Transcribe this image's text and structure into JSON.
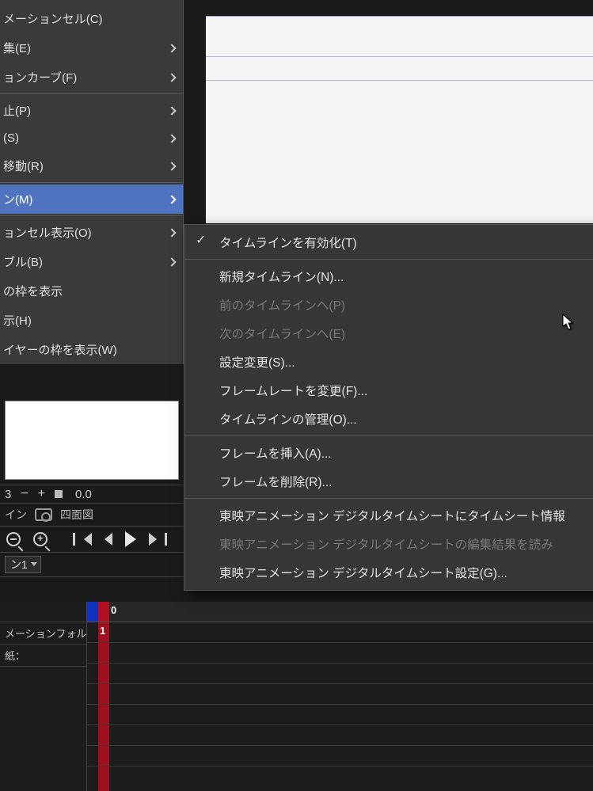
{
  "left_menu": {
    "items": [
      {
        "label": "メーションセル(C)"
      },
      {
        "label": "集(E)",
        "arrow": true
      },
      {
        "label": "ョンカーブ(F)",
        "arrow": true
      },
      {
        "label": "止(P)",
        "arrow": true,
        "sep_before": true
      },
      {
        "label": "(S)",
        "arrow": true
      },
      {
        "label": "移動(R)",
        "arrow": true
      },
      {
        "label": "ン(M)",
        "arrow": true,
        "selected": true,
        "sep_before": true
      },
      {
        "label": "ョンセル表示(O)",
        "arrow": true,
        "sep_before": true
      },
      {
        "label": "ブル(B)",
        "arrow": true
      },
      {
        "label": "の枠を表示"
      },
      {
        "label": "示(H)"
      },
      {
        "label": "イヤーの枠を表示(W)"
      }
    ]
  },
  "spin": {
    "value": "0.0"
  },
  "camera_row": {
    "label_left": "イン",
    "label_right": "四面図"
  },
  "track_select": {
    "value": "ン1"
  },
  "timeline": {
    "rows": [
      "メーションフォルダ",
      "紙："
    ],
    "frame0": "0",
    "frame1": "1"
  },
  "submenu": {
    "items": [
      {
        "label": "タイムラインを有効化(T)",
        "checked": true
      },
      {
        "label": "新規タイムライン(N)...",
        "sep_before": true
      },
      {
        "label": "前のタイムラインへ(P)",
        "disabled": true
      },
      {
        "label": "次のタイムラインへ(E)",
        "disabled": true
      },
      {
        "label": "設定変更(S)..."
      },
      {
        "label": "フレームレートを変更(F)..."
      },
      {
        "label": "タイムラインの管理(O)..."
      },
      {
        "label": "フレームを挿入(A)...",
        "sep_before": true
      },
      {
        "label": "フレームを削除(R)..."
      },
      {
        "label": "東映アニメーション  デジタルタイムシートにタイムシート情報",
        "sep_before": true
      },
      {
        "label": "東映アニメーション  デジタルタイムシートの編集結果を読み",
        "disabled": true
      },
      {
        "label": "東映アニメーション  デジタルタイムシート設定(G)..."
      }
    ]
  }
}
